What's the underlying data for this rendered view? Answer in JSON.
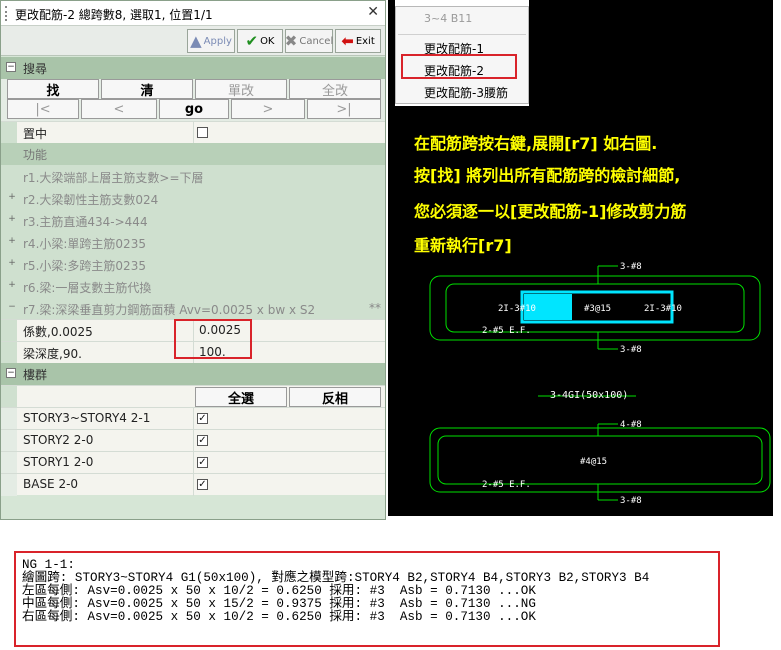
{
  "dialog": {
    "title": "更改配筋-2 總跨數8, 選取1, 位置1/1",
    "close_glyph": "✕",
    "toolbar": {
      "apply": "Apply",
      "ok": "OK",
      "cancel": "Cancel",
      "exit": "Exit"
    },
    "search": {
      "section_label": "搜尋",
      "find": "找",
      "clear": "清",
      "single_change": "單改",
      "change_all": "全改",
      "first": "|<",
      "prev": "<",
      "go": "go",
      "next": ">",
      "last": ">|",
      "center_label": "置中",
      "center_checked": false
    },
    "function": {
      "section_label": "功能",
      "items": [
        "r1.大梁端部上層主筋支數>=下層",
        "r2.大梁韌性主筋支數024",
        "r3.主筋直通434->444",
        "r4.小梁:單跨主筋0235",
        "r5.小梁:多跨主筋0235",
        "r6.梁:一層支數主筋代換",
        "r7.梁:深梁垂直剪力鋼筋面積 Avv=0.0025 x bw x S2"
      ],
      "r7_suffix": "**",
      "params": [
        {
          "label": "係數,0.0025",
          "value": "0.0025"
        },
        {
          "label": "梁深度,90.",
          "value": "100."
        }
      ]
    },
    "floors": {
      "section_label": "樓群",
      "select_all": "全選",
      "invert": "反相",
      "items": [
        {
          "label": "STORY3~STORY4 2-1",
          "checked": true
        },
        {
          "label": "STORY2 2-0",
          "checked": true
        },
        {
          "label": "STORY1 2-0",
          "checked": true
        },
        {
          "label": "BASE 2-0",
          "checked": true
        }
      ]
    }
  },
  "context_menu": {
    "header": "3~4 B11",
    "items": [
      "更改配筋-1",
      "更改配筋-2",
      "更改配筋-3腰筋"
    ],
    "highlighted_index": 1
  },
  "instructions": [
    "在配筋跨按右鍵,展開[r7] 如右圖.",
    "按[找] 將列出所有配筋跨的檢討細節,",
    "您必須逐一以[更改配筋-1]修改剪力筋",
    "重新執行[r7]"
  ],
  "drawing": {
    "beam1_top": "3-#8",
    "beam1_left": "2I-3#10",
    "beam1_mid": "#3@15",
    "beam1_right": "2I-3#10",
    "beam1_side": "2-#5 E.F.",
    "beam1_bottom": "3-#8",
    "beam2_title": "3-4GI(50x100)",
    "beam2_top": "4-#8",
    "beam2_mid": "#4@15",
    "beam2_side": "2-#5 E.F.",
    "beam2_bottom": "3-#8",
    "line_color": "#00e000",
    "highlight_color": "#00e5ff"
  },
  "log": {
    "lines": [
      "NG 1-1:",
      "繪圖跨: STORY3~STORY4 G1(50x100), 對應之模型跨:STORY4 B2,STORY4 B4,STORY3 B2,STORY3 B4",
      "左區每側: Asv=0.0025 x 50 x 10/2 = 0.6250 採用: #3  Asb = 0.7130 ...OK",
      "中區每側: Asv=0.0025 x 50 x 15/2 = 0.9375 採用: #3  Asb = 0.7130 ...NG",
      "右區每側: Asv=0.0025 x 50 x 10/2 = 0.6250 採用: #3  Asb = 0.7130 ...OK"
    ]
  },
  "colors": {
    "dialog_bg": "#d6e6d6",
    "section_bg": "#a9c4a9",
    "highlight_red": "#d9232a",
    "note_yellow": "#ffff00"
  }
}
